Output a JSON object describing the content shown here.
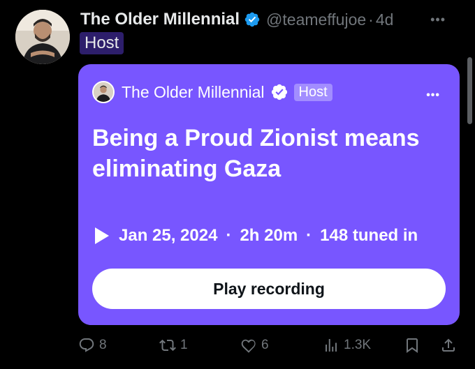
{
  "post": {
    "author_name": "The Older Millennial",
    "handle": "@teameffujoe",
    "separator": "·",
    "time": "4d",
    "more_label": "•••",
    "role_tag": "Host"
  },
  "space_card": {
    "host_name": "The Older Millennial",
    "host_tag": "Host",
    "more_label": "•••",
    "title": "Being a Proud Zionist means eliminating Gaza",
    "date": "Jan 25, 2024",
    "separator": "·",
    "duration": "2h 20m",
    "tuned_in": "148 tuned in",
    "play_button": "Play recording",
    "background_color": "#7856ff"
  },
  "actions": {
    "replies": "8",
    "reposts": "1",
    "likes": "6",
    "views": "1.3K"
  },
  "icons": [
    "verified-badge-icon",
    "reply-icon",
    "repost-icon",
    "like-icon",
    "views-icon",
    "bookmark-icon",
    "share-icon",
    "play-icon"
  ]
}
